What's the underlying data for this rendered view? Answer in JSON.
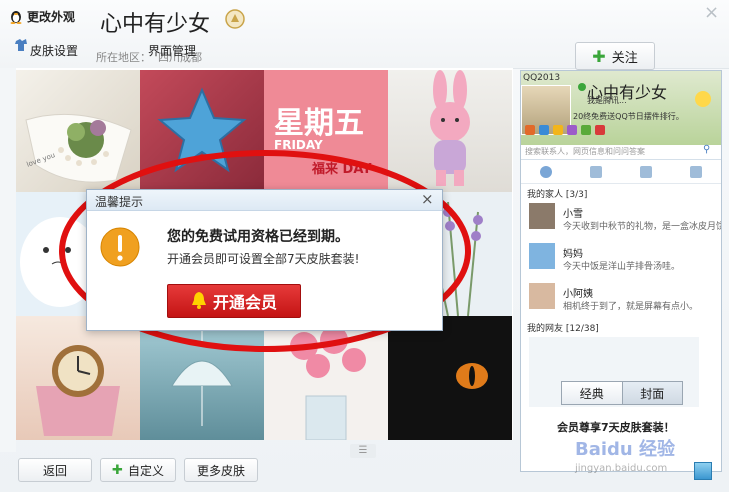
{
  "window": {
    "title": "更改外观",
    "profile_name": "心中有少女",
    "location_label": "所在地区：",
    "location_value": "四川成都",
    "menu": [
      "皮肤设置",
      "界面管理"
    ],
    "follow_label": "关注",
    "close_glyph": "×"
  },
  "tiles": {
    "friday_title": "星期五",
    "friday_sub": "FRIDAY",
    "friday_sub2": "福来 DAY",
    "cup_text": "love you"
  },
  "dialog": {
    "title": "温馨提示",
    "heading": "您的免费试用资格已经到期。",
    "message": "开通会员即可设置全部7天皮肤套装!",
    "action_label": "开通会员",
    "close_glyph": "×"
  },
  "panel": {
    "app_name": "QQ2013",
    "nickname": "心中有少女",
    "status_text": "我是腾讯...",
    "status_text2": "20终免费送QQ节日摆件排行。",
    "search_placeholder": "搜索联系人，网页信息和问问答案",
    "group1": "我的家人  [3/3]",
    "contacts": [
      {
        "name": "小雪",
        "msg": "今天收到中秋节的礼物，是一盒冰皮月饼"
      },
      {
        "name": "妈妈",
        "msg": "今天中饭是洋山芋排骨汤哇。"
      },
      {
        "name": "小阿姨",
        "msg": "相机终于到了，就是屏幕有点小。"
      }
    ],
    "group2": "我的网友  [12/38]",
    "tab_classic": "经典",
    "tab_cover": "封面",
    "member_note": "会员尊享7天皮肤套装！"
  },
  "footer": {
    "back": "返回",
    "custom": "自定义",
    "more": "更多皮肤"
  },
  "watermark": {
    "brand": "Baidu 经验",
    "url": "jingyan.baidu.com"
  },
  "colors": {
    "accent_green": "#3aa63a",
    "alert_orange": "#f0a020",
    "button_red": "#d21f1f",
    "highlight_circle": "#e01010"
  }
}
